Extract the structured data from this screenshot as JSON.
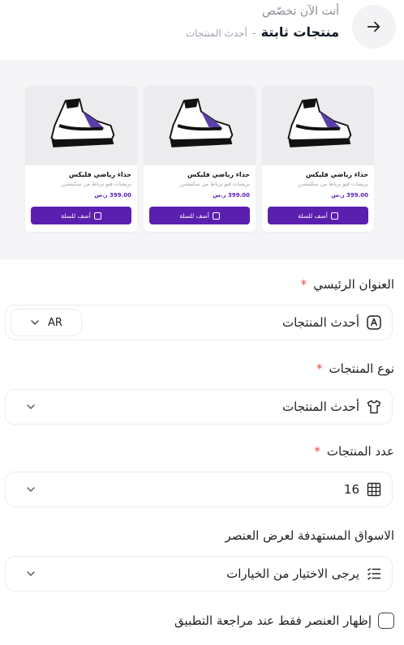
{
  "header": {
    "subtitle": "أنت الآن تخصّص",
    "title": "منتجات ثابتة",
    "separator": "-",
    "breadcrumb": "أحدث المنتجات"
  },
  "preview": {
    "cards": [
      {
        "name": "حذاء رياضي فليكس",
        "desc": "بريشات فيو برباط من سكيتشرز",
        "price": "399.00 ر.س",
        "button": "أضف للسلة"
      },
      {
        "name": "حذاء رياضي فليكس",
        "desc": "بريشات فيو برباط من سكيتشرز",
        "price": "399.00 ر.س",
        "button": "أضف للسلة"
      },
      {
        "name": "حذاء رياضي فليكس",
        "desc": "بريشات فيو برباط من سكيتشرز",
        "price": "399.00 ر.س",
        "button": "أضف للسلة"
      }
    ]
  },
  "form": {
    "main_title": {
      "label": "العنوان الرئيسي",
      "required": "*",
      "value": "أحدث المنتجات",
      "lang": "AR"
    },
    "product_type": {
      "label": "نوع المنتجات",
      "required": "*",
      "value": "أحدث المنتجات"
    },
    "product_count": {
      "label": "عدد المنتجات",
      "required": "*",
      "value": "16"
    },
    "markets": {
      "label": "الاسواق المستهدفة لعرض العنصر",
      "placeholder": "يرجى الاختيار من الخيارات"
    },
    "review_only": {
      "label": "إظهار العنصر فقط عند مراجعة التطبيق",
      "checked": false
    }
  },
  "colors": {
    "accent": "#5b1fb0",
    "required": "#ef4444",
    "preview_bg": "#f5f5f7"
  }
}
